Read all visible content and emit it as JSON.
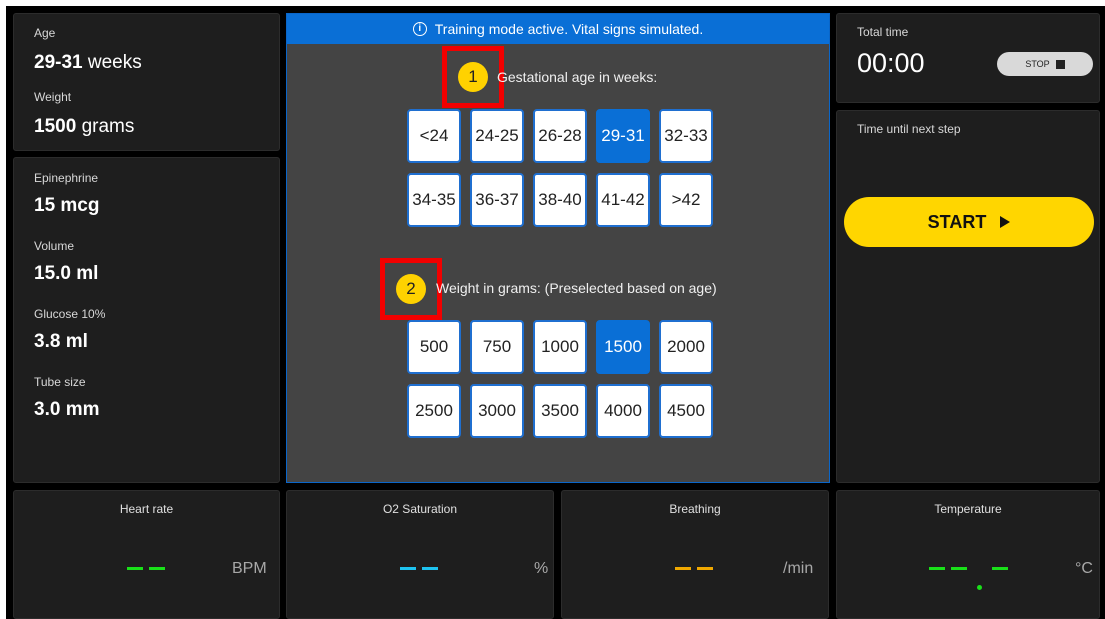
{
  "patient": {
    "age_label": "Age",
    "age_value": "29-31",
    "age_unit": "weeks",
    "weight_label": "Weight",
    "weight_value": "1500",
    "weight_unit": "grams"
  },
  "medication": [
    {
      "label": "Epinephrine",
      "value": "15 mcg"
    },
    {
      "label": "Volume",
      "value": "15.0 ml"
    },
    {
      "label": "Glucose 10%",
      "value": "3.8 ml"
    },
    {
      "label": "Tube size",
      "value": "3.0 mm"
    }
  ],
  "banner": {
    "icon": "info-icon",
    "text": "Training mode active. Vital signs simulated."
  },
  "gestation": {
    "step": "1",
    "title": "Gestational age in weeks:",
    "options": [
      "<24",
      "24-25",
      "26-28",
      "29-31",
      "32-33",
      "34-35",
      "36-37",
      "38-40",
      "41-42",
      ">42"
    ],
    "selected": "29-31"
  },
  "weight": {
    "step": "2",
    "title": "Weight in grams: (Preselected based on age)",
    "options": [
      "500",
      "750",
      "1000",
      "1500",
      "2000",
      "2500",
      "3000",
      "3500",
      "4000",
      "4500"
    ],
    "selected": "1500"
  },
  "timer": {
    "label": "Total time",
    "value": "00:00",
    "stop_label": "STOP",
    "next_label": "Time until next step",
    "start_label": "START"
  },
  "vitals": [
    {
      "title": "Heart rate",
      "value": "--",
      "unit": "BPM",
      "color": "#19e019"
    },
    {
      "title": "O2 Saturation",
      "value": "--",
      "unit": "%",
      "color": "#1ec3f0"
    },
    {
      "title": "Breathing",
      "value": "--",
      "unit": "/min",
      "color": "#f0a800"
    },
    {
      "title": "Temperature",
      "value": "--.-",
      "unit": "°C",
      "color": "#19e019"
    }
  ]
}
